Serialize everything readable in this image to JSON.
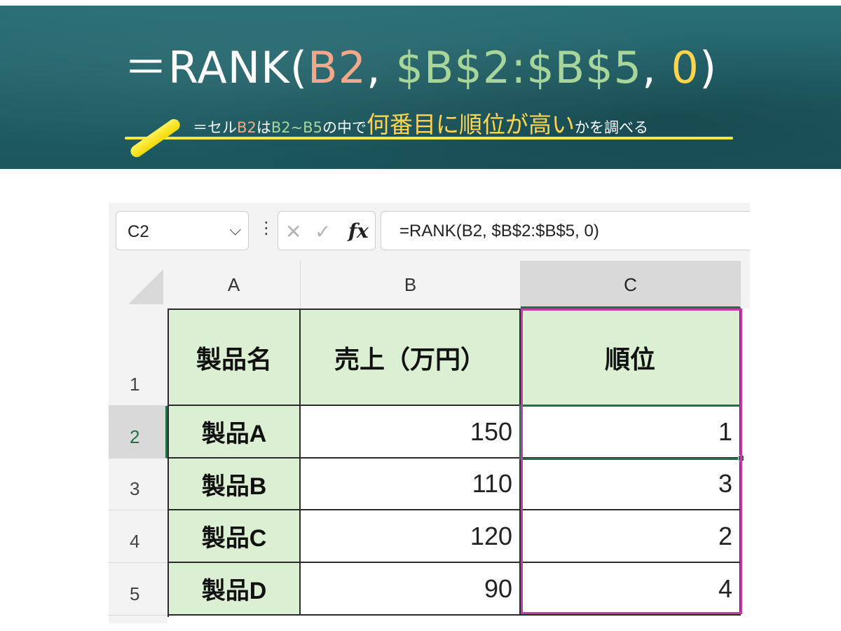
{
  "banner": {
    "formula": {
      "prefix": "＝RANK(",
      "arg1": "B2",
      "sep1": ", ",
      "arg2": "$B$2:$B$5",
      "sep2": ", ",
      "arg3": "0",
      "suffix": ")"
    },
    "explanation": {
      "part1": "＝セル",
      "cell": "B2",
      "part2": "は",
      "range": "B2~B5",
      "part3": "の中で",
      "emphasis": "何番目に順位が高い",
      "part4": "かを調べる"
    }
  },
  "formula_bar": {
    "name_box": "C2",
    "name_box_icon": "chevron-down-icon",
    "separator": "⋮",
    "cancel_icon": "✕",
    "enter_icon": "✓",
    "function_icon": "fx",
    "formula": "=RANK(B2, $B$2:$B$5, 0)"
  },
  "sheet": {
    "columns": [
      "A",
      "B",
      "C"
    ],
    "rows": [
      "1",
      "2",
      "3",
      "4",
      "5"
    ],
    "header": {
      "a": "製品名",
      "b": "売上（万円）",
      "c": "順位"
    },
    "data": [
      {
        "name": "製品A",
        "sales": "150",
        "rank": "1"
      },
      {
        "name": "製品B",
        "sales": "110",
        "rank": "3"
      },
      {
        "name": "製品C",
        "sales": "120",
        "rank": "2"
      },
      {
        "name": "製品D",
        "sales": "90",
        "rank": "4"
      }
    ],
    "active_cell": "C2",
    "colors": {
      "header_fill": "#dbf0d3",
      "highlight": "#c43aa6",
      "active": "#1e7145"
    }
  }
}
